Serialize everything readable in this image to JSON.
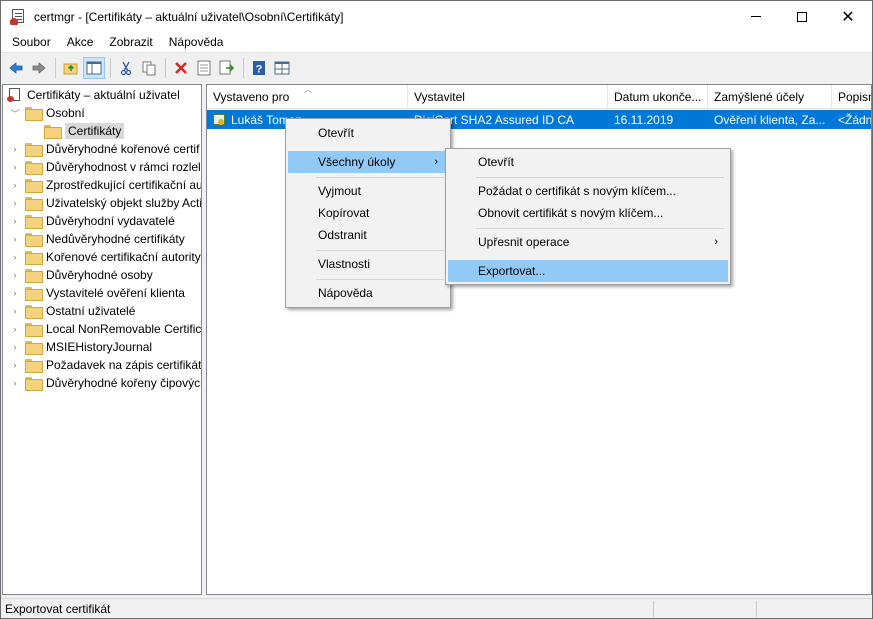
{
  "window": {
    "title": "certmgr - [Certifikáty – aktuální uživatel\\Osobní\\Certifikáty]"
  },
  "menubar": [
    "Soubor",
    "Akce",
    "Zobrazit",
    "Nápověda"
  ],
  "toolbar": {
    "icons": [
      "back-arrow-icon",
      "forward-arrow-icon",
      "up-folder-icon",
      "show-hide-tree-icon",
      "cut-icon",
      "copy-icon",
      "delete-icon",
      "properties-icon",
      "export-list-icon",
      "help-icon",
      "console-view-icon"
    ]
  },
  "tree": {
    "root": "Certifikáty – aktuální uživatel",
    "personal": "Osobní",
    "certificates": "Certifikáty",
    "items": [
      "Důvěryhodné kořenové certif",
      "Důvěryhodnost v rámci rozlel",
      "Zprostředkující certifikační au",
      "Uživatelský objekt služby Acti",
      "Důvěryhodní vydavatelé",
      "Nedůvěryhodné certifikáty",
      "Kořenové certifikační autority",
      "Důvěryhodné osoby",
      "Vystavitelé ověření klienta",
      "Ostatní uživatelé",
      "Local NonRemovable Certific",
      "MSIEHistoryJournal",
      "Požadavek na zápis certifikátu",
      "Důvěryhodné kořeny čipových"
    ]
  },
  "list": {
    "columns": [
      "Vystaveno pro",
      "Vystavitel",
      "Datum ukonče...",
      "Zamýšlené účely",
      "Popisn"
    ],
    "rows": [
      {
        "issued_to": "Lukáš Toman",
        "issuer": "DigiCert SHA2 Assured ID CA",
        "expires": "16.11.2019",
        "purposes": "Ověření klienta, Za...",
        "friendly": "<Žádn"
      }
    ]
  },
  "context_menu": {
    "items": [
      "Otevřít",
      "Všechny úkoly",
      "Vyjmout",
      "Kopírovat",
      "Odstranit",
      "Vlastnosti",
      "Nápověda"
    ]
  },
  "submenu": {
    "items": [
      "Otevřít",
      "Požádat o certifikát s novým klíčem...",
      "Obnovit certifikát s novým klíčem...",
      "Upřesnit operace",
      "Exportovat..."
    ]
  },
  "status": {
    "text": "Exportovat certifikát"
  },
  "colors": {
    "selection": "#0078d7",
    "menu_highlight": "#91c9f7"
  }
}
